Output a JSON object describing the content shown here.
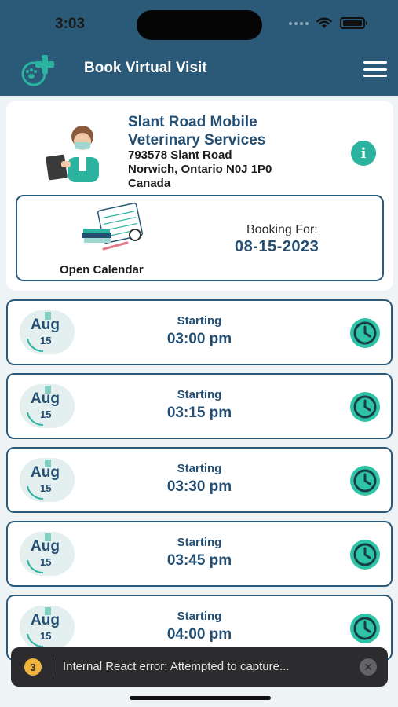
{
  "status_bar": {
    "time": "3:03"
  },
  "header": {
    "title": "Book Virtual Visit"
  },
  "provider": {
    "name": "Slant Road Mobile Veterinary Services",
    "address_line1": "793578 Slant Road",
    "address_line2": "Norwich, Ontario N0J 1P0",
    "address_line3": "Canada"
  },
  "calendar": {
    "open_label": "Open Calendar",
    "booking_label": "Booking For:",
    "booking_date": "08-15-2023"
  },
  "slots": [
    {
      "month": "Aug",
      "day": "15",
      "starting_label": "Starting",
      "time": "03:00 pm"
    },
    {
      "month": "Aug",
      "day": "15",
      "starting_label": "Starting",
      "time": "03:15 pm"
    },
    {
      "month": "Aug",
      "day": "15",
      "starting_label": "Starting",
      "time": "03:30 pm"
    },
    {
      "month": "Aug",
      "day": "15",
      "starting_label": "Starting",
      "time": "03:45 pm"
    },
    {
      "month": "Aug",
      "day": "15",
      "starting_label": "Starting",
      "time": "04:00 pm"
    }
  ],
  "toast": {
    "count": "3",
    "message": "Internal React error: Attempted to capture..."
  },
  "colors": {
    "header": "#2a5a78",
    "accent_teal": "#2bb3a0",
    "text_blue": "#244f73",
    "clock_green": "#2ec4a5"
  },
  "icons": {
    "logo": "paw-cross-logo",
    "menu": "hamburger-menu-icon",
    "info": "info-icon",
    "clock": "clock-icon",
    "close": "close-icon"
  }
}
